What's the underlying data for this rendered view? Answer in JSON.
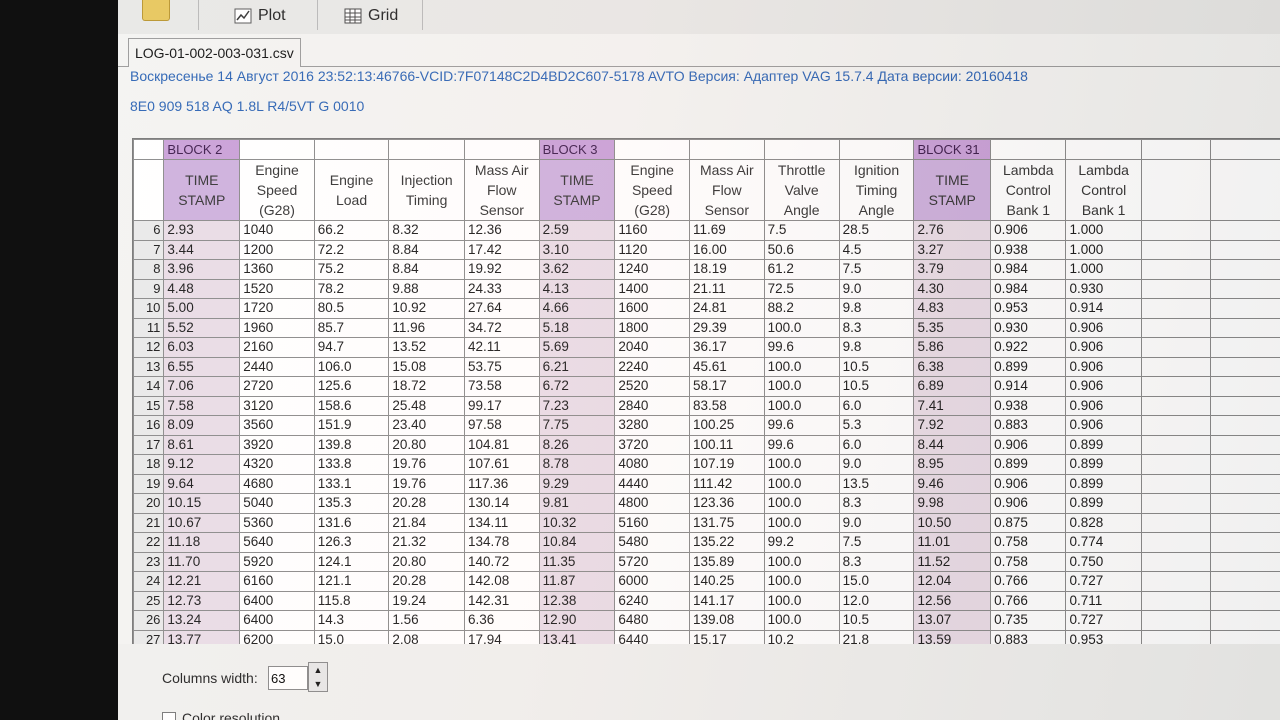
{
  "toolbar": {
    "plot_label": "Plot",
    "grid_label": "Grid"
  },
  "file_tab": "LOG-01-002-003-031.csv",
  "info_line1": "Воскресенье 14 Август 2016 23:52:13:46766-VCID:7F07148C2D4BD2C607-5178 AVTO Версия: Адаптер VAG 15.7.4 Дата версии: 20160418",
  "info_line2": "8E0 909 518 AQ  1.8L R4/5VT    G  0010",
  "blocks": [
    "BLOCK 2",
    "BLOCK 3",
    "BLOCK 31"
  ],
  "columns": [
    "TIME STAMP",
    "Engine Speed (G28)",
    "Engine Load",
    "Injection Timing",
    "Mass Air Flow Sensor",
    "TIME STAMP",
    "Engine Speed (G28)",
    "Mass Air Flow Sensor",
    "Throttle Valve Angle",
    "Ignition Timing Angle",
    "TIME STAMP",
    "Lambda Control Bank 1",
    "Lambda Control Bank 1"
  ],
  "rows": [
    [
      "6",
      "2.93",
      "1040",
      "66.2",
      "8.32",
      "12.36",
      "2.59",
      "1160",
      "11.69",
      "7.5",
      "28.5",
      "2.76",
      "0.906",
      "1.000"
    ],
    [
      "7",
      "3.44",
      "1200",
      "72.2",
      "8.84",
      "17.42",
      "3.10",
      "1120",
      "16.00",
      "50.6",
      "4.5",
      "3.27",
      "0.938",
      "1.000"
    ],
    [
      "8",
      "3.96",
      "1360",
      "75.2",
      "8.84",
      "19.92",
      "3.62",
      "1240",
      "18.19",
      "61.2",
      "7.5",
      "3.79",
      "0.984",
      "1.000"
    ],
    [
      "9",
      "4.48",
      "1520",
      "78.2",
      "9.88",
      "24.33",
      "4.13",
      "1400",
      "21.11",
      "72.5",
      "9.0",
      "4.30",
      "0.984",
      "0.930"
    ],
    [
      "10",
      "5.00",
      "1720",
      "80.5",
      "10.92",
      "27.64",
      "4.66",
      "1600",
      "24.81",
      "88.2",
      "9.8",
      "4.83",
      "0.953",
      "0.914"
    ],
    [
      "11",
      "5.52",
      "1960",
      "85.7",
      "11.96",
      "34.72",
      "5.18",
      "1800",
      "29.39",
      "100.0",
      "8.3",
      "5.35",
      "0.930",
      "0.906"
    ],
    [
      "12",
      "6.03",
      "2160",
      "94.7",
      "13.52",
      "42.11",
      "5.69",
      "2040",
      "36.17",
      "99.6",
      "9.8",
      "5.86",
      "0.922",
      "0.906"
    ],
    [
      "13",
      "6.55",
      "2440",
      "106.0",
      "15.08",
      "53.75",
      "6.21",
      "2240",
      "45.61",
      "100.0",
      "10.5",
      "6.38",
      "0.899",
      "0.906"
    ],
    [
      "14",
      "7.06",
      "2720",
      "125.6",
      "18.72",
      "73.58",
      "6.72",
      "2520",
      "58.17",
      "100.0",
      "10.5",
      "6.89",
      "0.914",
      "0.906"
    ],
    [
      "15",
      "7.58",
      "3120",
      "158.6",
      "25.48",
      "99.17",
      "7.23",
      "2840",
      "83.58",
      "100.0",
      "6.0",
      "7.41",
      "0.938",
      "0.906"
    ],
    [
      "16",
      "8.09",
      "3560",
      "151.9",
      "23.40",
      "97.58",
      "7.75",
      "3280",
      "100.25",
      "99.6",
      "5.3",
      "7.92",
      "0.883",
      "0.906"
    ],
    [
      "17",
      "8.61",
      "3920",
      "139.8",
      "20.80",
      "104.81",
      "8.26",
      "3720",
      "100.11",
      "99.6",
      "6.0",
      "8.44",
      "0.906",
      "0.899"
    ],
    [
      "18",
      "9.12",
      "4320",
      "133.8",
      "19.76",
      "107.61",
      "8.78",
      "4080",
      "107.19",
      "100.0",
      "9.0",
      "8.95",
      "0.899",
      "0.899"
    ],
    [
      "19",
      "9.64",
      "4680",
      "133.1",
      "19.76",
      "117.36",
      "9.29",
      "4440",
      "111.42",
      "100.0",
      "13.5",
      "9.46",
      "0.906",
      "0.899"
    ],
    [
      "20",
      "10.15",
      "5040",
      "135.3",
      "20.28",
      "130.14",
      "9.81",
      "4800",
      "123.36",
      "100.0",
      "8.3",
      "9.98",
      "0.906",
      "0.899"
    ],
    [
      "21",
      "10.67",
      "5360",
      "131.6",
      "21.84",
      "134.11",
      "10.32",
      "5160",
      "131.75",
      "100.0",
      "9.0",
      "10.50",
      "0.875",
      "0.828"
    ],
    [
      "22",
      "11.18",
      "5640",
      "126.3",
      "21.32",
      "134.78",
      "10.84",
      "5480",
      "135.22",
      "99.2",
      "7.5",
      "11.01",
      "0.758",
      "0.774"
    ],
    [
      "23",
      "11.70",
      "5920",
      "124.1",
      "20.80",
      "140.72",
      "11.35",
      "5720",
      "135.89",
      "100.0",
      "8.3",
      "11.52",
      "0.758",
      "0.750"
    ],
    [
      "24",
      "12.21",
      "6160",
      "121.1",
      "20.28",
      "142.08",
      "11.87",
      "6000",
      "140.25",
      "100.0",
      "15.0",
      "12.04",
      "0.766",
      "0.727"
    ],
    [
      "25",
      "12.73",
      "6400",
      "115.8",
      "19.24",
      "142.31",
      "12.38",
      "6240",
      "141.17",
      "100.0",
      "12.0",
      "12.56",
      "0.766",
      "0.711"
    ],
    [
      "26",
      "13.24",
      "6400",
      "14.3",
      "1.56",
      "6.36",
      "12.90",
      "6480",
      "139.08",
      "100.0",
      "10.5",
      "13.07",
      "0.735",
      "0.727"
    ],
    [
      "27",
      "13.77",
      "6200",
      "15.0",
      "2.08",
      "17.94",
      "13.41",
      "6440",
      "15.17",
      "10.2",
      "21.8",
      "13.59",
      "0.883",
      "0.953"
    ]
  ],
  "columns_width_label": "Columns width:",
  "columns_width_value": "63",
  "checkbox_label": "Color resolution"
}
